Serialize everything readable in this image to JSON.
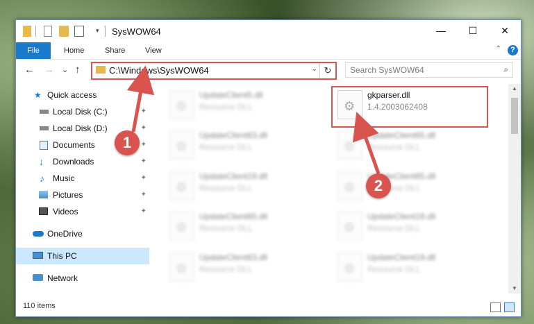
{
  "window": {
    "title": "SysWOW64",
    "minimize_glyph": "—",
    "maximize_glyph": "☐",
    "close_glyph": "✕"
  },
  "ribbon": {
    "tabs": [
      "File",
      "Home",
      "Share",
      "View"
    ],
    "help_glyph": "?",
    "collapse_glyph": "⌃"
  },
  "navigation": {
    "back_glyph": "←",
    "forward_glyph": "→",
    "recent_glyph": "⌄",
    "up_glyph": "↑",
    "address": "C:\\Windows\\SysWOW64",
    "address_dropdown_glyph": "⌄",
    "refresh_glyph": "↻",
    "search_placeholder": "Search SysWOW64",
    "search_glyph": "⌕"
  },
  "sidebar": {
    "items": [
      {
        "label": "Quick access",
        "icon": "star-icon",
        "pinned": false
      },
      {
        "label": "Local Disk (C:)",
        "icon": "drive-icon",
        "pinned": true
      },
      {
        "label": "Local Disk (D:)",
        "icon": "drive-icon",
        "pinned": true
      },
      {
        "label": "Documents",
        "icon": "documents-icon",
        "pinned": true
      },
      {
        "label": "Downloads",
        "icon": "download-icon",
        "pinned": true
      },
      {
        "label": "Music",
        "icon": "music-icon",
        "pinned": true
      },
      {
        "label": "Pictures",
        "icon": "pictures-icon",
        "pinned": true
      },
      {
        "label": "Videos",
        "icon": "videos-icon",
        "pinned": true
      },
      {
        "label": "OneDrive",
        "icon": "cloud-icon",
        "pinned": false
      },
      {
        "label": "This PC",
        "icon": "computer-icon",
        "pinned": false,
        "selected": true
      },
      {
        "label": "Network",
        "icon": "network-icon",
        "pinned": false
      }
    ],
    "pin_glyph": "✦"
  },
  "files": {
    "highlighted": {
      "name": "gkparser.dll",
      "description": "1.4.2003062408"
    },
    "blurred": [
      {
        "name": "UpdateClient5.dll",
        "description": "Resource DLL"
      },
      {
        "name": "UpdateClient63.dll",
        "description": "Resource DLL"
      },
      {
        "name": "UpdateClient65.dll",
        "description": "Resource DLL"
      },
      {
        "name": "UpdateClient19.dll",
        "description": "Resource DLL"
      },
      {
        "name": "UpdateClient65.dll",
        "description": "Resource DLL"
      },
      {
        "name": "UpdateClient65.dll",
        "description": "Resource DLL"
      },
      {
        "name": "UpdateClient19.dll",
        "description": "Resource DLL"
      },
      {
        "name": "UpdateClient63.dll",
        "description": "Resource DLL"
      },
      {
        "name": "UpdateClient19.dll",
        "description": "Resource DLL"
      }
    ]
  },
  "status": {
    "item_count": "110 items"
  },
  "callouts": {
    "step1": "1",
    "step2": "2",
    "color": "#d9534f"
  },
  "colors": {
    "accent": "#1979ca",
    "selected_bg": "#cce8ff",
    "highlight_border": "#d9534f"
  }
}
